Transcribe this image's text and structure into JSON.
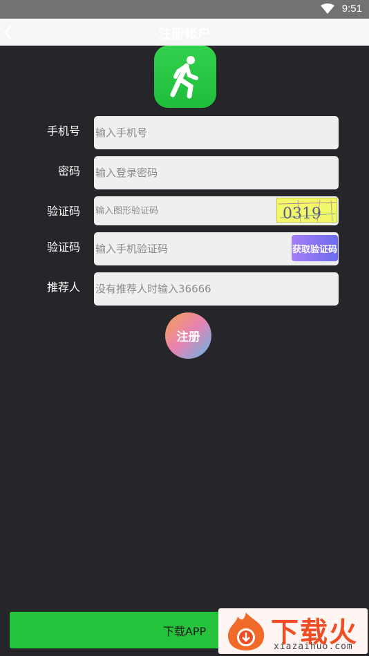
{
  "status_bar": {
    "time": "9:51",
    "wifi_icon": "wifi-icon"
  },
  "nav": {
    "title": "注册帐户",
    "back_icon": "chevron-left-icon"
  },
  "logo": {
    "icon": "running-person-icon",
    "color": "#2ac845"
  },
  "form": {
    "phone": {
      "label": "手机号",
      "placeholder": "输入手机号"
    },
    "password": {
      "label": "密码",
      "placeholder": "输入登录密码"
    },
    "captcha": {
      "label": "验证码",
      "placeholder": "输入图形验证码",
      "image_text": "0319"
    },
    "sms": {
      "label": "验证码",
      "placeholder": "输入手机验证码",
      "button": "获取验证码"
    },
    "referrer": {
      "label": "推荐人",
      "placeholder": "没有推荐人时输入36666"
    }
  },
  "register_button": "注册",
  "download_button": "下载APP",
  "watermark": {
    "brand": "下载火",
    "url": "xiazaihuo.com"
  },
  "colors": {
    "background": "#262529",
    "accent_green": "#25c33b",
    "sms_purple": "#8a72f2"
  }
}
